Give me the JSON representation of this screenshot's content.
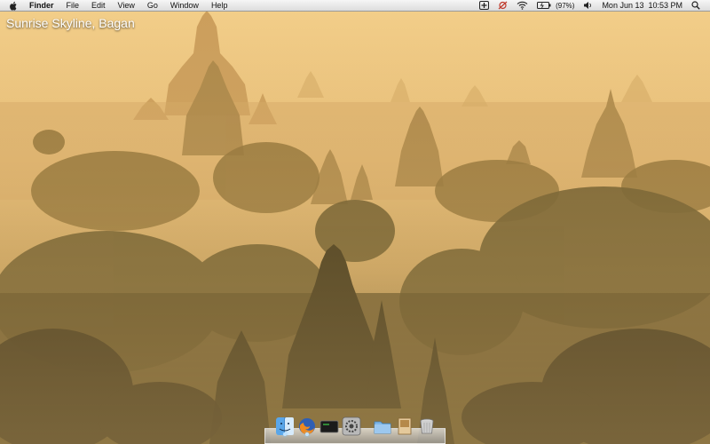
{
  "menubar": {
    "apple_icon": "apple-logo-icon",
    "app_name": "Finder",
    "menus": [
      "File",
      "Edit",
      "View",
      "Go",
      "Window",
      "Help"
    ],
    "status": {
      "icons": [
        "time-machine-icon",
        "adium-icon",
        "wifi-icon",
        "battery-icon",
        "volume-icon",
        "spotlight-icon"
      ],
      "battery_percent": "(97%)",
      "datetime": "Mon Jun 13  10:53 PM"
    }
  },
  "desktop": {
    "caption": "Sunrise Skyline, Bagan"
  },
  "dock": {
    "items": [
      "finder",
      "firefox",
      "terminal",
      "system-preferences",
      "folder",
      "preview",
      "trash"
    ]
  },
  "colors": {
    "sky_top": "#f1c983",
    "sky_mid": "#ddb070",
    "haze": "#c99a52",
    "foreground": "#3b3218"
  }
}
